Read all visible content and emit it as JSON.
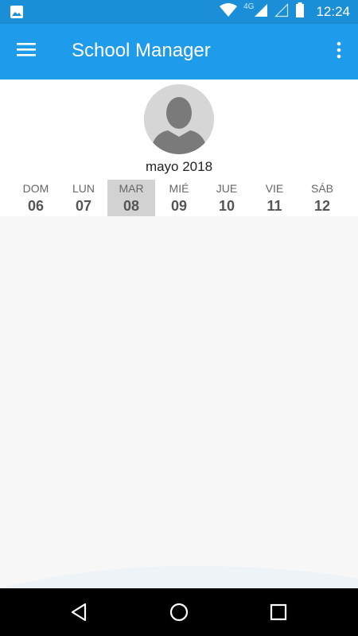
{
  "status_bar": {
    "time": "12:24",
    "network": "4G",
    "icons": [
      "image-icon",
      "wifi-icon",
      "signal-icon",
      "signal-empty-icon",
      "battery-icon"
    ]
  },
  "app_bar": {
    "title": "School Manager",
    "menu_icon": "hamburger-menu-icon",
    "overflow_icon": "more-vert-icon",
    "color": "#1e9bea"
  },
  "header": {
    "avatar_icon": "person-avatar-icon",
    "month_label": "mayo 2018",
    "week": [
      {
        "name": "DOM",
        "num": "06",
        "selected": false
      },
      {
        "name": "LUN",
        "num": "07",
        "selected": false
      },
      {
        "name": "MAR",
        "num": "08",
        "selected": true
      },
      {
        "name": "MIÉ",
        "num": "09",
        "selected": false
      },
      {
        "name": "JUE",
        "num": "10",
        "selected": false
      },
      {
        "name": "VIE",
        "num": "11",
        "selected": false
      },
      {
        "name": "SÁB",
        "num": "12",
        "selected": false
      }
    ]
  },
  "nav_bar": {
    "icons": [
      "back-triangle-icon",
      "home-circle-icon",
      "recents-square-icon"
    ]
  }
}
